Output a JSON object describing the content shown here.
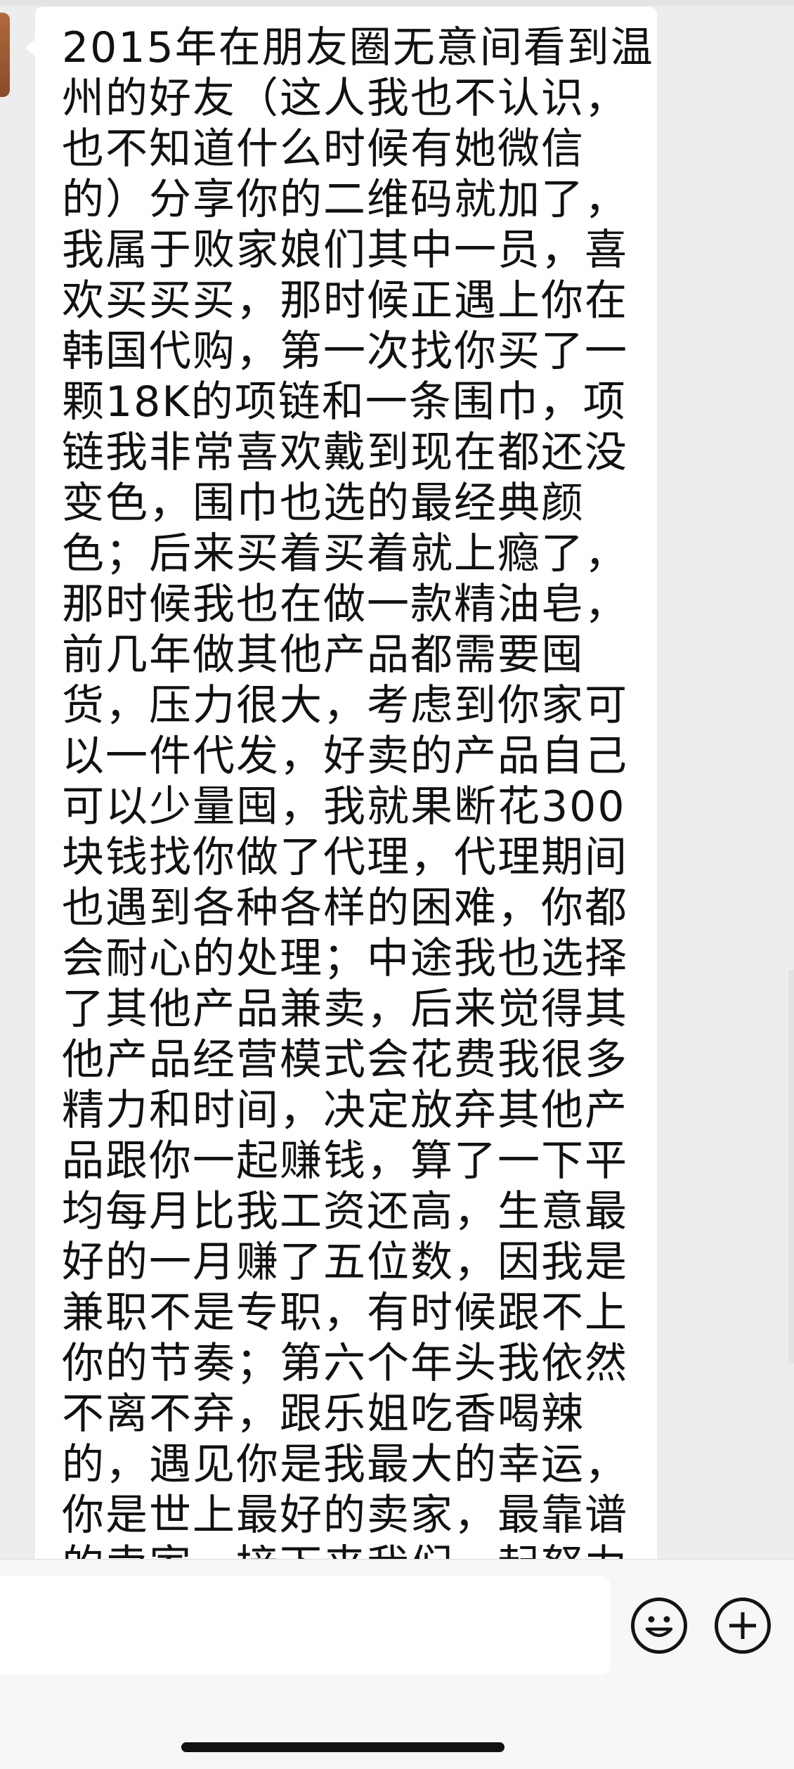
{
  "chat": {
    "message": {
      "lines": [
        "2015年在朋友圈无意间看到温",
        "州的好友（这人我也不认识，",
        "也不知道什么时候有她微信",
        "的）分享你的二维码就加了，",
        "我属于败家娘们其中一员，喜",
        "欢买买买，那时候正遇上你在",
        "韩国代购，第一次找你买了一",
        "颗18K的项链和一条围巾，项",
        "链我非常喜欢戴到现在都还没",
        "变色，围巾也选的最经典颜",
        "色；后来买着买着就上瘾了，",
        "那时候我也在做一款精油皂，",
        "前几年做其他产品都需要囤",
        "货，压力很大，考虑到你家可",
        "以一件代发，好卖的产品自己",
        "可以少量囤，我就果断花300",
        "块钱找你做了代理，代理期间",
        "也遇到各种各样的困难，你都",
        "会耐心的处理；中途我也选择",
        "了其他产品兼卖，后来觉得其",
        "他产品经营模式会花费我很多",
        "精力和时间，决定放弃其他产",
        "品跟你一起赚钱，算了一下平",
        "均每月比我工资还高，生意最",
        "好的一月赚了五位数，因我是",
        "兼职不是专职，有时候跟不上",
        "你的节奏；第六个年头我依然",
        "不离不弃，跟乐姐吃香喝辣",
        "的，遇见你是我最大的幸运，",
        "你是世上最好的卖家，最靠谱",
        "的卖家，接下来我们一起努力"
      ]
    }
  },
  "input_bar": {
    "placeholder": "",
    "emoji_icon": "smiley-face-icon",
    "plus_icon": "plus-circle-icon"
  },
  "colors": {
    "background": "#ededed",
    "bubble": "#ffffff",
    "text": "#111111"
  }
}
